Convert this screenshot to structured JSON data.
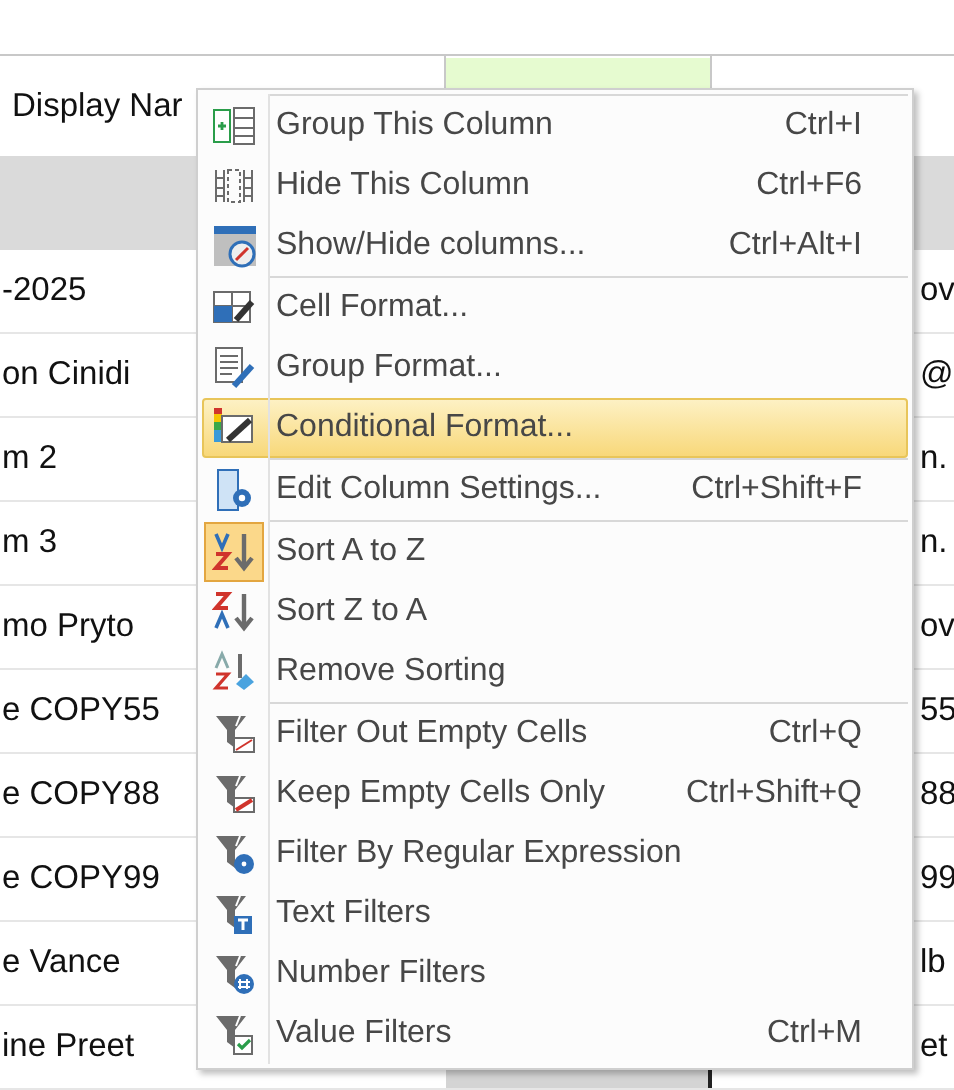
{
  "table": {
    "header": {
      "column_1": "Display Nar"
    },
    "rows": [
      {
        "column_1": "-2025",
        "column_3": "ov"
      },
      {
        "column_1": "on Cinidi",
        "column_3": "@"
      },
      {
        "column_1": "m 2",
        "column_3": "n."
      },
      {
        "column_1": "m 3",
        "column_3": "n."
      },
      {
        "column_1": "mo Pryto",
        "column_3": "ov"
      },
      {
        "column_1": "e COPY55",
        "column_3": "55"
      },
      {
        "column_1": "e COPY88",
        "column_3": "88"
      },
      {
        "column_1": "e COPY99",
        "column_3": "99"
      },
      {
        "column_1": "e Vance",
        "column_3": "lb"
      },
      {
        "column_1": "ine Preet",
        "column_3": "et"
      }
    ]
  },
  "context_menu": {
    "groups": [
      [
        {
          "label": "Group This Column",
          "shortcut": "Ctrl+I",
          "selected": false,
          "checked": false
        },
        {
          "label": "Hide This Column",
          "shortcut": "Ctrl+F6",
          "selected": false,
          "checked": false
        },
        {
          "label": "Show/Hide columns...",
          "shortcut": "Ctrl+Alt+I",
          "selected": false,
          "checked": false
        }
      ],
      [
        {
          "label": "Cell Format...",
          "selected": false,
          "checked": false
        },
        {
          "label": "Group Format...",
          "selected": false,
          "checked": false
        },
        {
          "label": "Conditional Format...",
          "selected": true,
          "checked": false
        }
      ],
      [
        {
          "label": "Edit Column Settings...",
          "shortcut": "Ctrl+Shift+F",
          "selected": false,
          "checked": false
        }
      ],
      [
        {
          "label": "Sort A to Z",
          "selected": false,
          "checked": true
        },
        {
          "label": "Sort Z to A",
          "selected": false,
          "checked": false
        },
        {
          "label": "Remove Sorting",
          "selected": false,
          "checked": false
        }
      ],
      [
        {
          "label": "Filter Out Empty Cells",
          "shortcut": "Ctrl+Q",
          "selected": false,
          "checked": false
        },
        {
          "label": "Keep Empty Cells Only",
          "shortcut": "Ctrl+Shift+Q",
          "selected": false,
          "checked": false
        },
        {
          "label": "Filter By Regular Expression",
          "selected": false,
          "checked": false
        },
        {
          "label": "Text Filters",
          "selected": false,
          "checked": false
        },
        {
          "label": "Number Filters",
          "selected": false,
          "checked": false
        },
        {
          "label": "Value Filters",
          "shortcut": "Ctrl+M",
          "selected": false,
          "checked": false
        }
      ]
    ]
  }
}
